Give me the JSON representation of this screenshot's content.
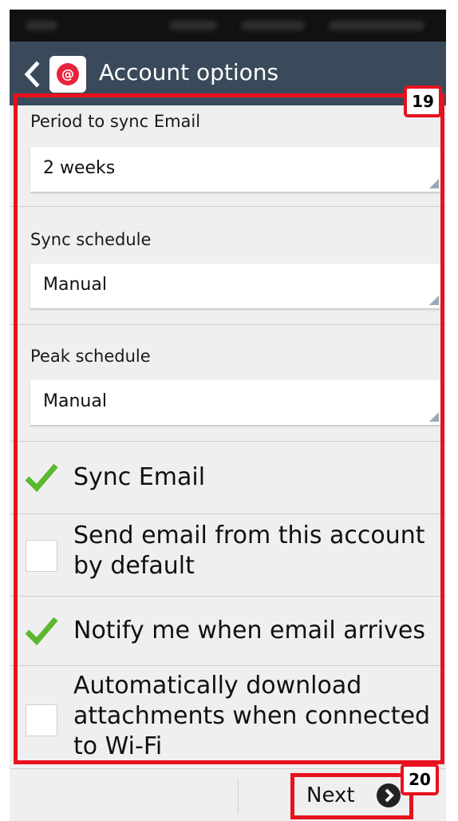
{
  "app": {
    "title": "Account options"
  },
  "settings": {
    "sync_period": {
      "label": "Period to sync Email",
      "value": "2 weeks"
    },
    "sync_schedule": {
      "label": "Sync schedule",
      "value": "Manual"
    },
    "peak_schedule": {
      "label": "Peak schedule",
      "value": "Manual"
    }
  },
  "checkboxes": [
    {
      "label": "Sync Email",
      "checked": true
    },
    {
      "label": "Send email from this account by default",
      "checked": false
    },
    {
      "label": "Notify me when email arrives",
      "checked": true
    },
    {
      "label": "Automatically download attachments when connected to Wi-Fi",
      "checked": false
    }
  ],
  "footer": {
    "next_label": "Next"
  },
  "annotations": {
    "box1_tag": "19",
    "box2_tag": "20"
  },
  "colors": {
    "actionbar": "#3a4a5b",
    "check": "#5cb82e",
    "annotation": "#e8111d"
  }
}
